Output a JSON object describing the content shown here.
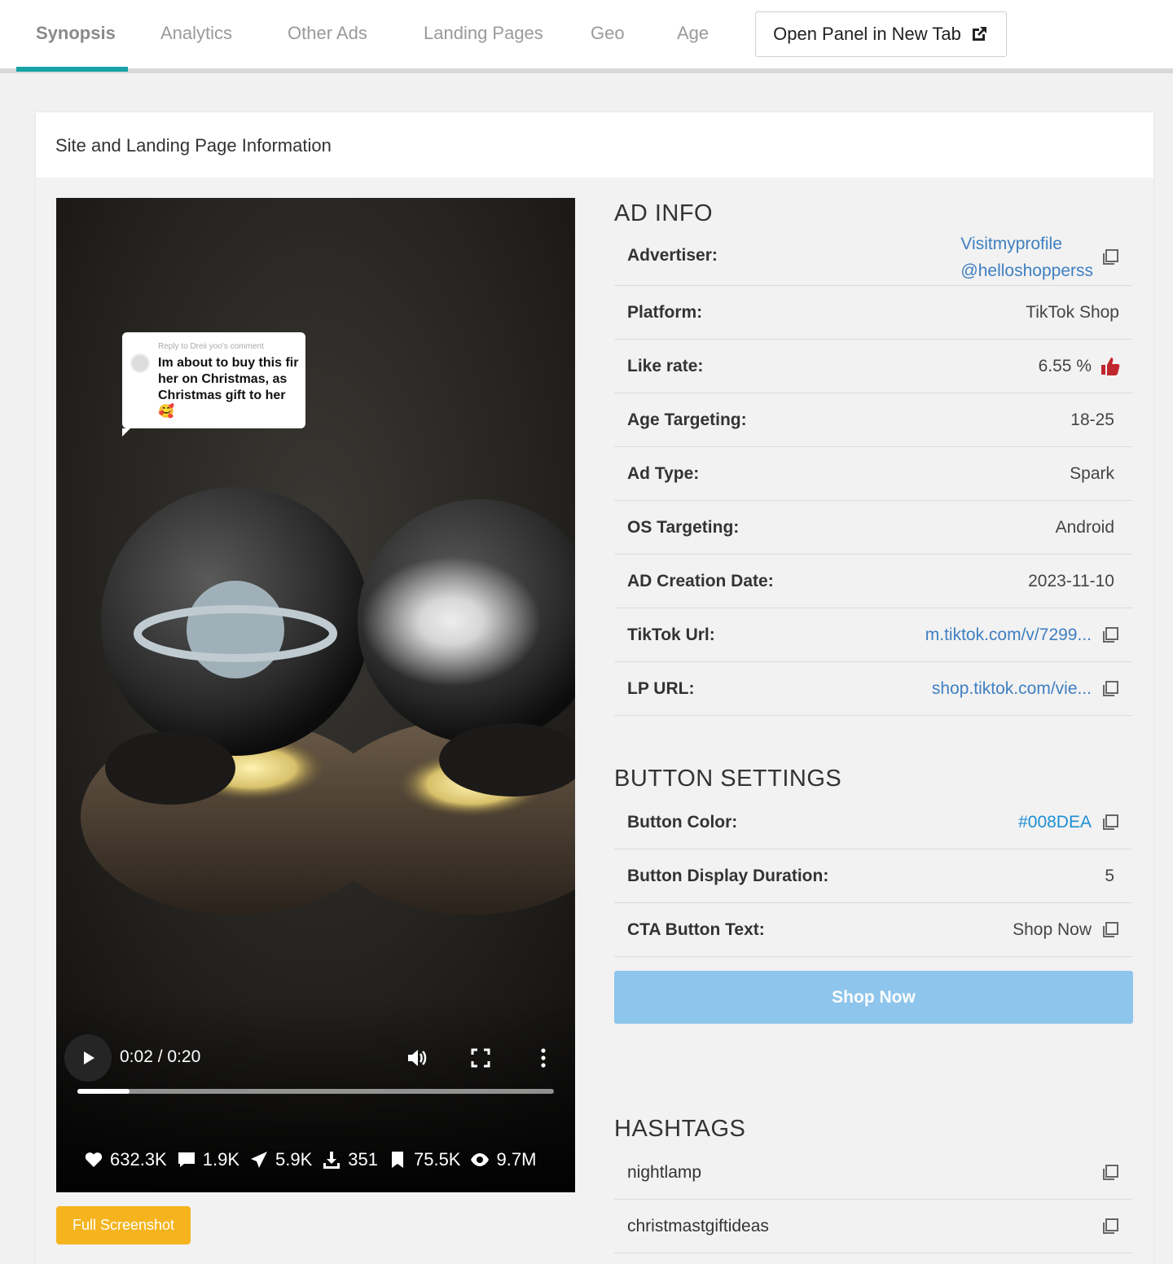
{
  "tabs": [
    {
      "label": "Synopsis",
      "active": true
    },
    {
      "label": "Analytics"
    },
    {
      "label": "Other Ads"
    },
    {
      "label": "Landing Pages"
    },
    {
      "label": "Geo"
    },
    {
      "label": "Age"
    }
  ],
  "open_panel_label": "Open Panel in New Tab",
  "card_title": "Site and Landing Page Information",
  "video": {
    "comment_reply": "Reply to Dreii yoo's comment",
    "comment_text": "Im about to buy this fir her on Christmas, as Christmas gift to her🥰",
    "time": "0:02 / 0:20",
    "progress_fraction": 0.11,
    "stats": {
      "likes": "632.3K",
      "comments": "1.9K",
      "shares": "5.9K",
      "downloads": "351",
      "saves": "75.5K",
      "views": "9.7M"
    }
  },
  "full_screenshot_label": "Full Screenshot",
  "ad_info": {
    "title": "AD INFO",
    "advertiser_label": "Advertiser:",
    "advertiser_name": "Visitmyprofile",
    "advertiser_handle": "@helloshopperss",
    "platform_label": "Platform:",
    "platform_value": "TikTok Shop",
    "like_rate_label": "Like rate:",
    "like_rate_value": "6.55 %",
    "age_label": "Age Targeting:",
    "age_value": "18-25",
    "ad_type_label": "Ad Type:",
    "ad_type_value": "Spark",
    "os_label": "OS Targeting:",
    "os_value": "Android",
    "creation_label": "AD Creation Date:",
    "creation_value": "2023-11-10",
    "tiktok_url_label": "TikTok Url:",
    "tiktok_url_value": "m.tiktok.com/v/7299...",
    "lp_url_label": "LP URL:",
    "lp_url_value": "shop.tiktok.com/vie..."
  },
  "button_settings": {
    "title": "BUTTON SETTINGS",
    "color_label": "Button Color:",
    "color_value": "#008DEA",
    "duration_label": "Button Display Duration:",
    "duration_value": "5",
    "cta_label": "CTA Button Text:",
    "cta_value": "Shop Now",
    "preview_label": "Shop Now"
  },
  "hashtags": {
    "title": "HASHTAGS",
    "items": [
      "nightlamp",
      "christmastgiftideas"
    ]
  },
  "colors": {
    "accent": "#17a2a6",
    "link": "#3f7fc1",
    "screenshot_button": "#f5b41e",
    "cta_preview": "#8ec5ec"
  }
}
